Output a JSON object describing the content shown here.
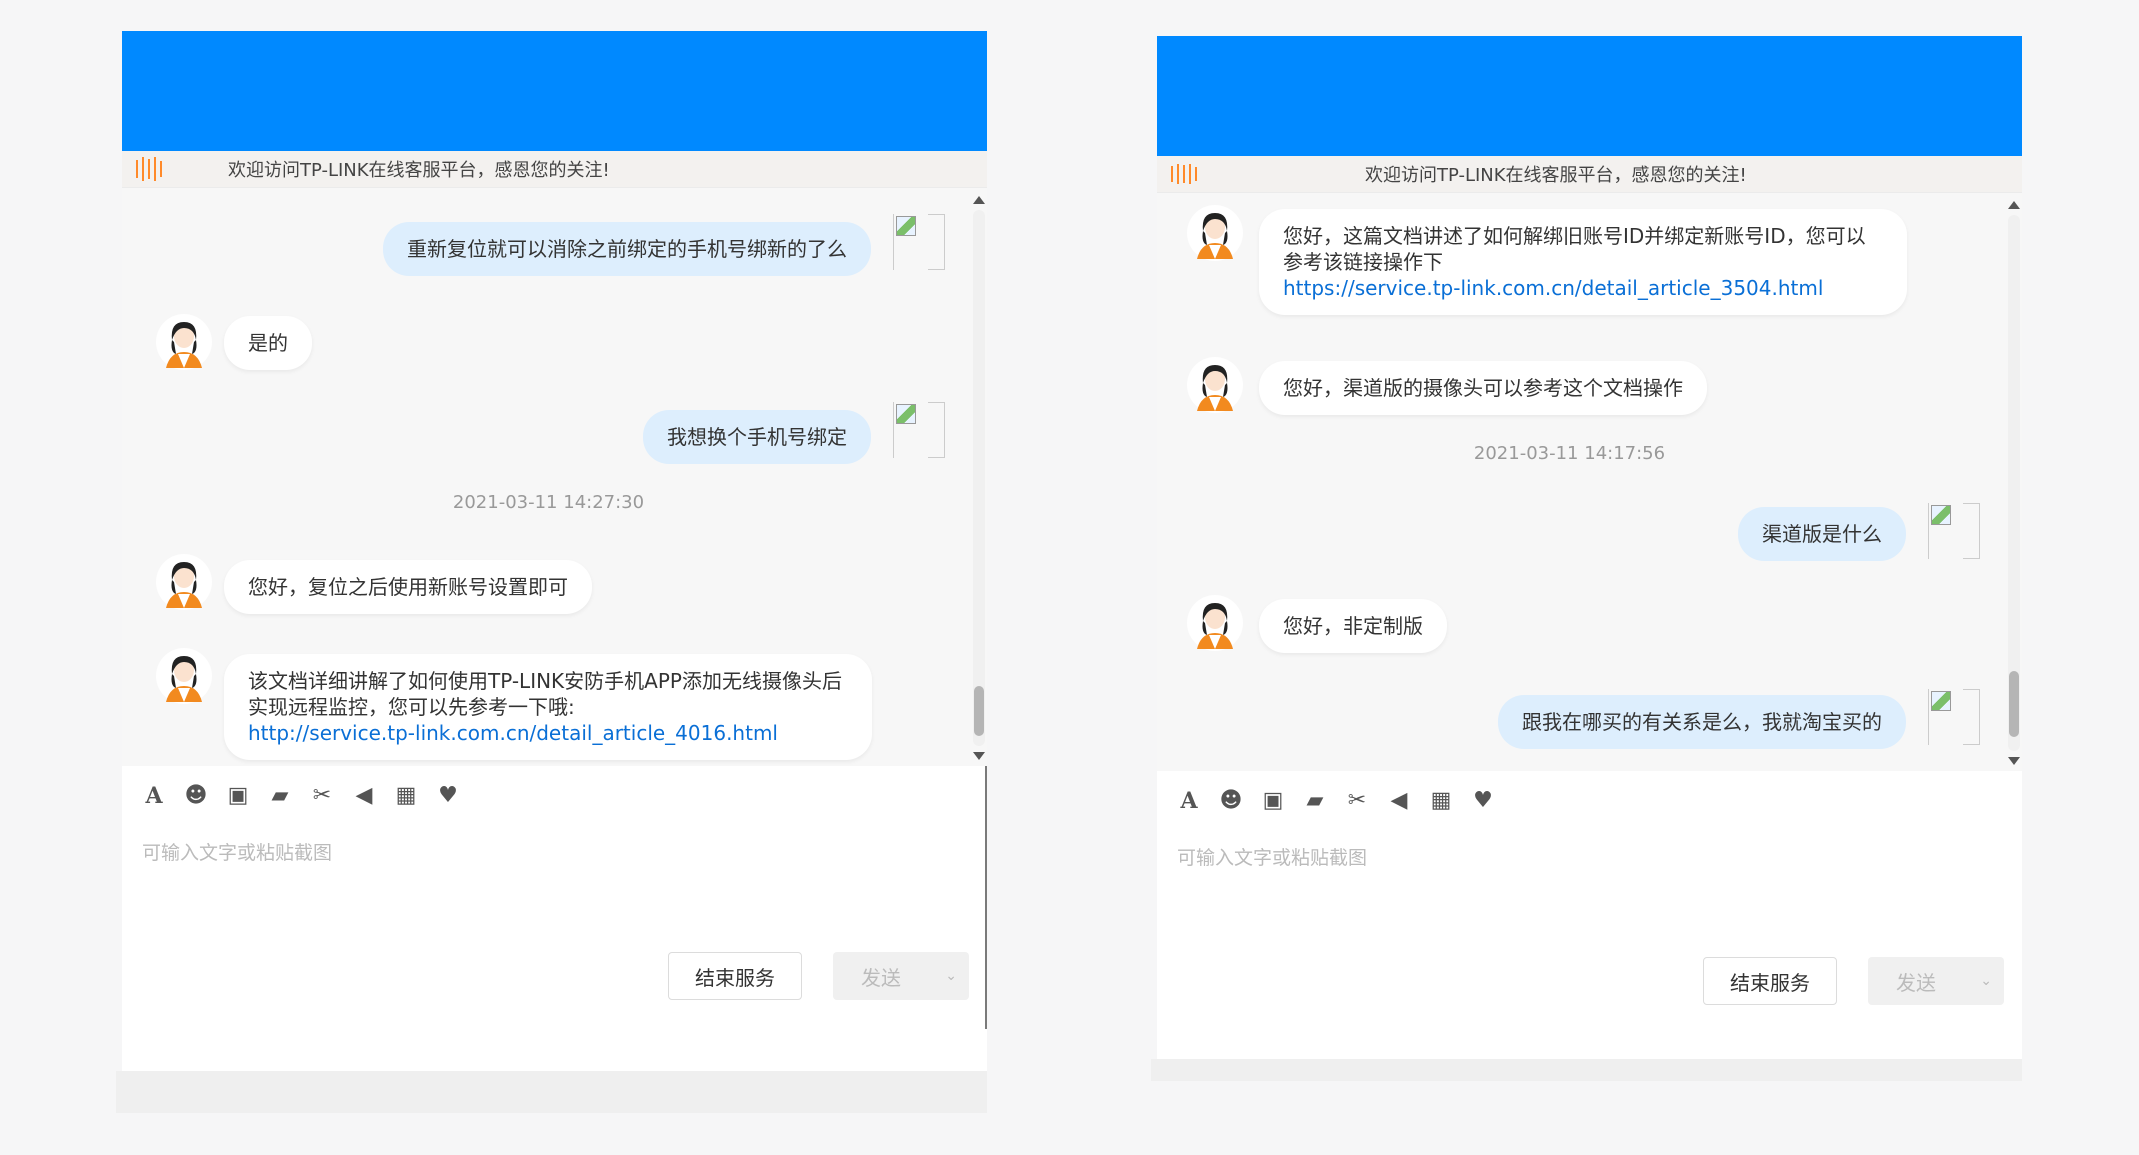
{
  "colors": {
    "header": "#0089ff",
    "notice_bar_bg": "#f3f1ef",
    "notice_icon": "#ff8a2a",
    "agent_bubble": "#ffffff",
    "user_bubble": "#ddeefd",
    "link": "#0a6fd6"
  },
  "left": {
    "notice_text": "欢迎访问TP-LINK在线客服平台，感恩您的关注!",
    "messages": [
      {
        "role": "user",
        "text": "重新复位就可以消除之前绑定的手机号绑新的了么"
      },
      {
        "role": "agent",
        "text": "是的"
      },
      {
        "role": "user",
        "text": "我想换个手机号绑定"
      },
      {
        "role": "timestamp",
        "text": "2021-03-11 14:27:30"
      },
      {
        "role": "agent",
        "text": "您好，复位之后使用新账号设置即可"
      },
      {
        "role": "agent",
        "text": "该文档详细讲解了如何使用TP-LINK安防手机APP添加无线摄像头后实现远程监控，您可以先参考一下哦:",
        "link": "http://service.tp-link.com.cn/detail_article_4016.html"
      }
    ],
    "toolbar_icons": [
      "font-icon",
      "emoji-icon",
      "image-icon",
      "folder-icon",
      "scissors-icon",
      "volume-icon",
      "qrcode-icon",
      "heart-icon"
    ],
    "input_placeholder": "可输入文字或粘贴截图",
    "end_button": "结束服务",
    "send_button": "发送"
  },
  "right": {
    "notice_text": "欢迎访问TP-LINK在线客服平台，感恩您的关注!",
    "messages": [
      {
        "role": "agent",
        "text": "您好，这篇文档讲述了如何解绑旧账号ID并绑定新账号ID，您可以参考该链接操作下",
        "link": "https://service.tp-link.com.cn/detail_article_3504.html"
      },
      {
        "role": "agent",
        "text": "您好，渠道版的摄像头可以参考这个文档操作"
      },
      {
        "role": "timestamp",
        "text": "2021-03-11 14:17:56"
      },
      {
        "role": "user",
        "text": "渠道版是什么"
      },
      {
        "role": "agent",
        "text": "您好，非定制版"
      },
      {
        "role": "user",
        "text": "跟我在哪买的有关系是么，我就淘宝买的"
      }
    ],
    "toolbar_icons": [
      "font-icon",
      "emoji-icon",
      "image-icon",
      "folder-icon",
      "scissors-icon",
      "volume-icon",
      "qrcode-icon",
      "heart-icon"
    ],
    "input_placeholder": "可输入文字或粘贴截图",
    "end_button": "结束服务",
    "send_button": "发送"
  }
}
